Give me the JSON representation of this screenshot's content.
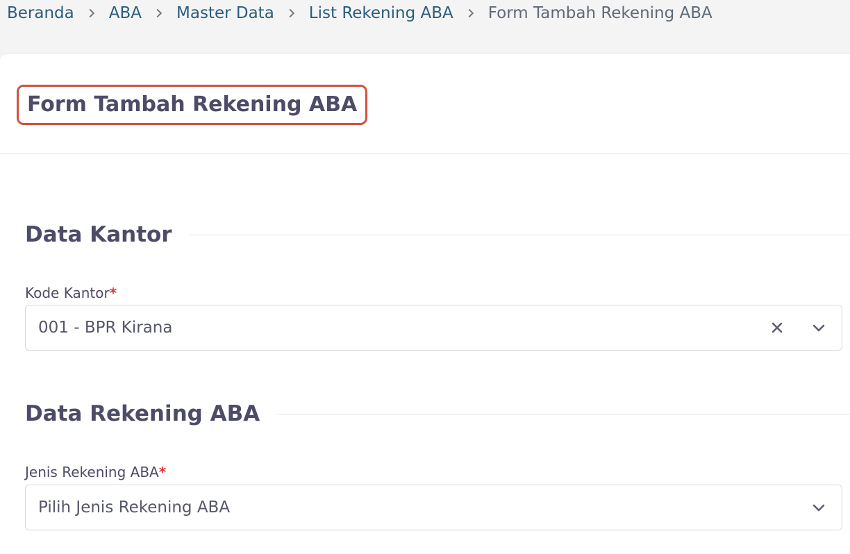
{
  "breadcrumb": {
    "items": [
      "Beranda",
      "ABA",
      "Master Data",
      "List Rekening ABA"
    ],
    "current": "Form Tambah Rekening ABA"
  },
  "page": {
    "title": "Form Tambah Rekening ABA"
  },
  "sections": {
    "kantor": {
      "title": "Data Kantor",
      "kode_kantor_label": "Kode Kantor",
      "required_mark": "*",
      "kode_kantor_value": "001 - BPR Kirana"
    },
    "rekening": {
      "title": "Data Rekening ABA",
      "jenis_label": "Jenis Rekening ABA",
      "required_mark": "*",
      "jenis_placeholder": "Pilih Jenis Rekening ABA"
    }
  },
  "colors": {
    "link": "#2b5d7a",
    "title_highlight": "#d0523f",
    "required": "#e03131"
  },
  "icons": {
    "separator": "chevron-right-icon",
    "clear": "close-icon",
    "dropdown": "chevron-down-icon"
  }
}
